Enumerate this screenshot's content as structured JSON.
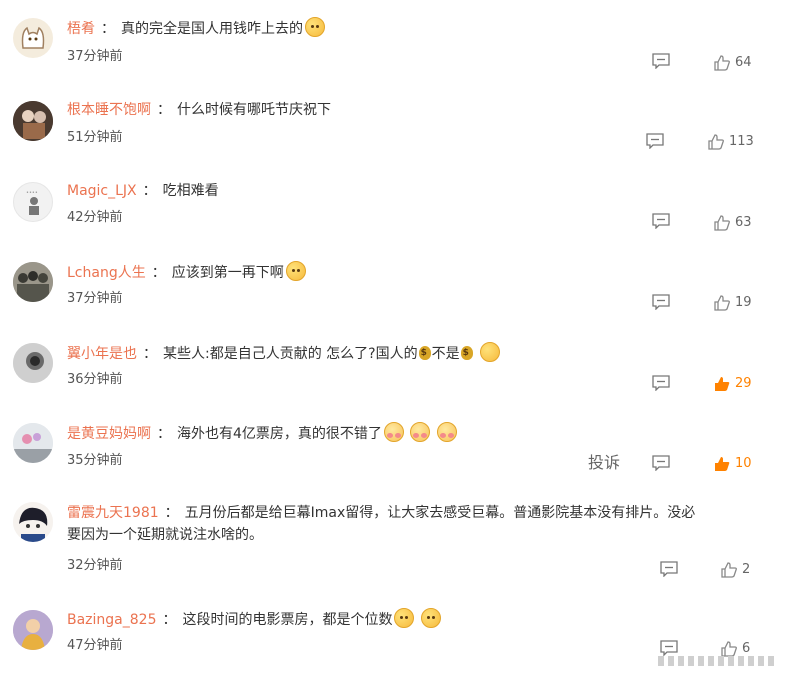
{
  "comments": [
    {
      "user": "梧肴",
      "sep": "：",
      "text": "真的完全是国人用钱咋上去的",
      "time": "37分钟前",
      "likes": "64",
      "hot": false,
      "emojis": [
        "dog"
      ]
    },
    {
      "user": "根本睡不饱啊",
      "sep": "：",
      "text": "什么时候有哪吒节庆祝下",
      "time": "51分钟前",
      "likes": "113",
      "hot": false,
      "emojis": []
    },
    {
      "user": "Magic_LJX",
      "sep": "：",
      "text": "吃相难看",
      "time": "42分钟前",
      "likes": "63",
      "hot": false,
      "emojis": []
    },
    {
      "user": "Lchang人生",
      "sep": "：",
      "text": "应该到第一再下啊",
      "time": "37分钟前",
      "likes": "19",
      "hot": false,
      "emojis": [
        "dog"
      ]
    },
    {
      "user": "翼小年是也",
      "sep": "：",
      "text_a": "某些人:都是自己人贡献的 怎么了?国人的",
      "text_b": "不是",
      "time": "36分钟前",
      "likes": "29",
      "hot": true
    },
    {
      "user": "是黄豆妈妈啊",
      "sep": "：",
      "text": "海外也有4亿票房，真的很不错了",
      "time": "35分钟前",
      "likes": "10",
      "hot": true,
      "report": "投诉",
      "emojis": [
        "shy",
        "shy",
        "shy"
      ]
    },
    {
      "user": "雷震九天1981",
      "sep": "：",
      "text": "五月份后都是给巨幕Imax留得，让大家去感受巨幕。普通影院基本没有排片。没必要因为一个延期就说注水啥的。",
      "time": "32分钟前",
      "likes": "2",
      "hot": false
    },
    {
      "user": "Bazinga_825",
      "sep": "：",
      "text": "这段时间的电影票房，都是个位数",
      "time": "47分钟前",
      "likes": "6",
      "hot": false,
      "emojis": [
        "dog",
        "dog"
      ]
    }
  ],
  "colors": {
    "username": "#eb7350",
    "hot_like": "#ff8200",
    "text": "#333333",
    "meta": "#666666"
  }
}
